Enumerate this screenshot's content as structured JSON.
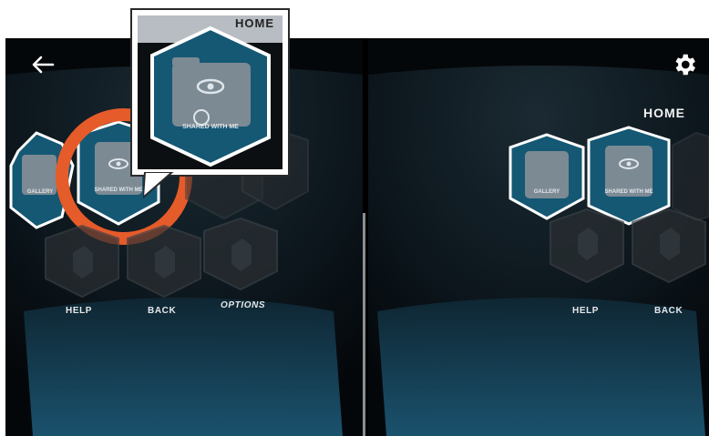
{
  "header": {
    "back_icon": "arrow-left-icon",
    "settings_icon": "gear-icon",
    "title": "HOME",
    "title_cutoff": "HOME"
  },
  "left_eye": {
    "tiles": [
      {
        "label": "GALLERY"
      },
      {
        "label": "SHARED WITH ME"
      }
    ],
    "menu": {
      "help": "HELP",
      "back": "BACK",
      "options": "OPTIONS"
    }
  },
  "right_eye": {
    "title": "HOME",
    "tiles": [
      {
        "label": "GALLERY"
      },
      {
        "label": "SHARED WITH ME"
      }
    ],
    "menu": {
      "help": "HELP",
      "back": "BACK"
    }
  },
  "callout": {
    "tile_label": "SHARED WITH ME"
  },
  "colors": {
    "tile_fill": "#165a78",
    "tile_border": "#ffffff",
    "highlight_ring": "#e55b2a",
    "background": "#05080a"
  }
}
